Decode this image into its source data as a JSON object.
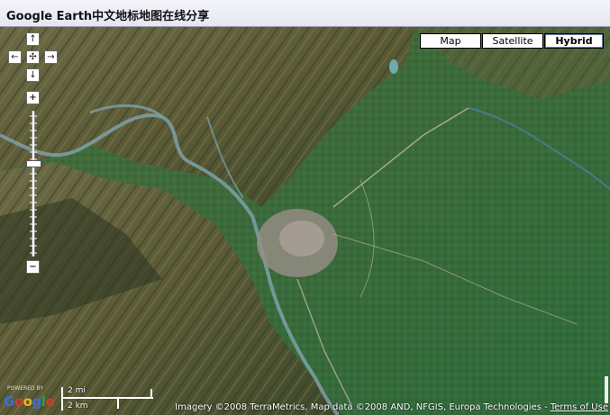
{
  "header": {
    "title": "Google Earth中文地标地图在线分享"
  },
  "nav": {
    "up": "↑",
    "left": "←",
    "center": "✣",
    "right": "→",
    "down": "↓",
    "zoom_in": "+",
    "zoom_out": "−"
  },
  "map_types": [
    {
      "label": "Map",
      "active": false
    },
    {
      "label": "Satellite",
      "active": false
    },
    {
      "label": "Hybrid",
      "active": true
    }
  ],
  "scale": {
    "imperial": "2 mi",
    "metric": "2 km"
  },
  "branding": {
    "powered_by": "POWERED BY",
    "logo": "Google"
  },
  "copyright": {
    "text": "Imagery ©2008 TerraMetrics, Map data ©2008 AND, NFGIS, Europa Technologies - ",
    "terms": "Terms of Use"
  },
  "colors": {
    "mountain": "#5a6a3a",
    "valley": "#3f6e3a",
    "river": "#7fa0a8",
    "town": "#9a8f88"
  }
}
